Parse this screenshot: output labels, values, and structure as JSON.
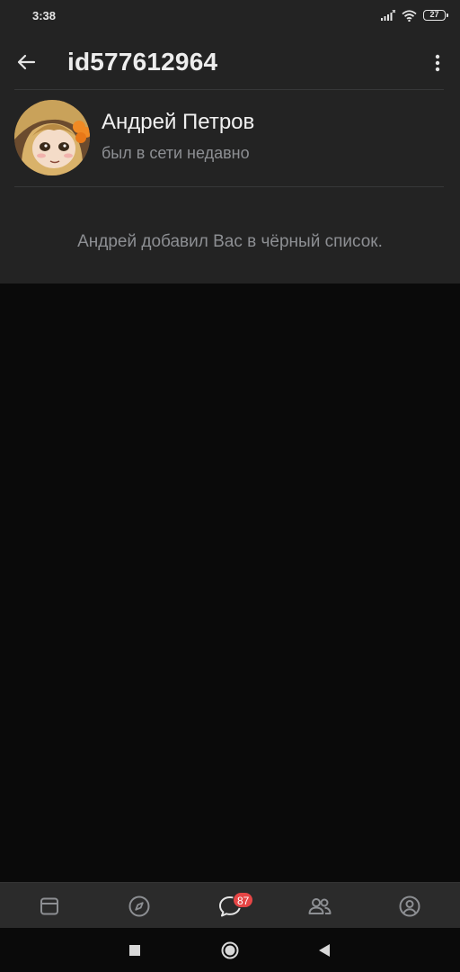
{
  "status_bar": {
    "time": "3:38",
    "battery": "27",
    "icons": [
      "signal-icon",
      "wifi-icon",
      "battery-icon"
    ]
  },
  "header": {
    "title": "id577612964",
    "back_icon": "arrow-left-icon",
    "more_icon": "more-vertical-icon"
  },
  "profile": {
    "name": "Андрей Петров",
    "status": "был в сети недавно",
    "avatar_icon": "avatar-image"
  },
  "notice": "Андрей добавил Вас в чёрный список.",
  "tab_bar": {
    "tabs": [
      {
        "icon": "news-icon",
        "active": false
      },
      {
        "icon": "compass-icon",
        "active": false
      },
      {
        "icon": "messages-icon",
        "active": true,
        "badge": "87"
      },
      {
        "icon": "friends-icon",
        "active": false
      },
      {
        "icon": "profile-icon",
        "active": false
      }
    ]
  },
  "nav_bar": {
    "buttons": [
      "recents-icon",
      "home-icon",
      "back-triangle-icon"
    ]
  },
  "colors": {
    "panel_bg": "#232323",
    "screen_bg": "#0a0a0a",
    "secondary_text": "#8d8f93",
    "badge": "#e64646"
  }
}
